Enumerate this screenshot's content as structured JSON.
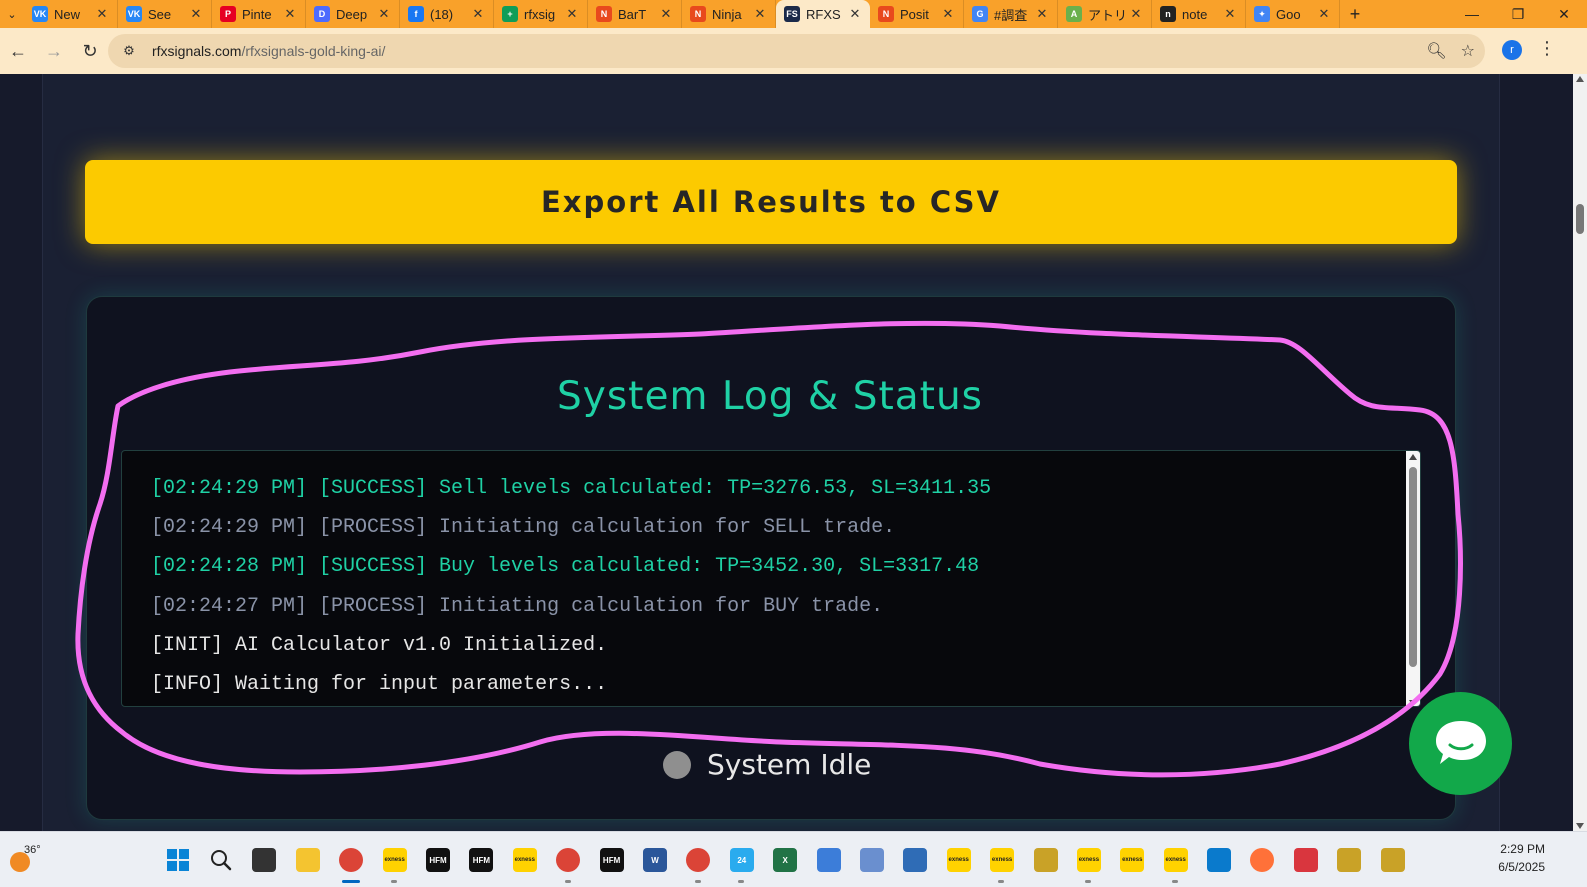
{
  "browser": {
    "tabs": [
      {
        "label": "New",
        "fav_text": "VK",
        "fav_color": "#2787f5"
      },
      {
        "label": "See",
        "fav_text": "VK",
        "fav_color": "#2787f5"
      },
      {
        "label": "Pinte",
        "fav_text": "P",
        "fav_color": "#e60023"
      },
      {
        "label": "Deep",
        "fav_text": "D",
        "fav_color": "#4d6bfe"
      },
      {
        "label": "(18)",
        "fav_text": "f",
        "fav_color": "#1877f2"
      },
      {
        "label": "rfxsig",
        "fav_text": "+",
        "fav_color": "#0f9d58"
      },
      {
        "label": "BarT",
        "fav_text": "N",
        "fav_color": "#e8491d"
      },
      {
        "label": "Ninja",
        "fav_text": "N",
        "fav_color": "#e8491d"
      },
      {
        "label": "RFXS",
        "fav_text": "FS",
        "fav_color": "#1b2a4a",
        "active": true
      },
      {
        "label": "Posit",
        "fav_text": "N",
        "fav_color": "#e8491d"
      },
      {
        "label": "#調査",
        "fav_text": "G",
        "fav_color": "#4285f4"
      },
      {
        "label": "アトリ",
        "fav_text": "A",
        "fav_color": "#6ab04c"
      },
      {
        "label": "note",
        "fav_text": "n",
        "fav_color": "#222222"
      },
      {
        "label": "Goo",
        "fav_text": "✦",
        "fav_color": "#4285f4"
      }
    ],
    "url_host": "rfxsignals.com",
    "url_path": "/rfxsignals-gold-king-ai/",
    "profile_initial": "r"
  },
  "page": {
    "export_button": "Export All Results to CSV",
    "log_title": "System Log & Status",
    "log_lines": [
      {
        "text": "[02:24:29 PM] [SUCCESS] Sell levels calculated: TP=3276.53, SL=3411.35",
        "color": "#1fd1a5"
      },
      {
        "text": "[02:24:29 PM] [PROCESS] Initiating calculation for SELL trade.",
        "color": "#8a93a8"
      },
      {
        "text": "[02:24:28 PM] [SUCCESS] Buy levels calculated: TP=3452.30, SL=3317.48",
        "color": "#1fd1a5"
      },
      {
        "text": "[02:24:27 PM] [PROCESS] Initiating calculation for BUY trade.",
        "color": "#8a93a8"
      },
      {
        "text": "[INIT] AI Calculator v1.0 Initialized.",
        "color": "#e6e6e6"
      },
      {
        "text": "[INFO] Waiting for input parameters...",
        "color": "#e6e6e6"
      }
    ],
    "status_text": "System Idle",
    "status_color": "#8f8f8f",
    "annotation_color": "#f36ef0"
  },
  "taskbar": {
    "weather_temp": "36°",
    "apps": [
      {
        "name": "start-icon",
        "color": "#0078d4",
        "text": ""
      },
      {
        "name": "search-icon",
        "color": "transparent",
        "text": ""
      },
      {
        "name": "task-view-icon",
        "color": "#333333",
        "text": ""
      },
      {
        "name": "file-explorer-icon",
        "color": "#f4c430",
        "text": ""
      },
      {
        "name": "chrome-icon",
        "color": "#db4437",
        "text": ""
      },
      {
        "name": "exness-icon",
        "color": "#ffd200",
        "text": "exness"
      },
      {
        "name": "hfm-icon",
        "color": "#111111",
        "text": "HFM"
      },
      {
        "name": "hfm-icon",
        "color": "#111111",
        "text": "HFM"
      },
      {
        "name": "exness-icon",
        "color": "#ffd200",
        "text": "exness"
      },
      {
        "name": "chrome-icon",
        "color": "#db4437",
        "text": ""
      },
      {
        "name": "hfm-icon",
        "color": "#111111",
        "text": "HFM"
      },
      {
        "name": "word-icon",
        "color": "#2b579a",
        "text": "W"
      },
      {
        "name": "chrome-icon",
        "color": "#db4437",
        "text": ""
      },
      {
        "name": "telegram-icon",
        "color": "#2aabee",
        "text": "24"
      },
      {
        "name": "excel-icon",
        "color": "#217346",
        "text": "X"
      },
      {
        "name": "notepad-icon",
        "color": "#3c7dd9",
        "text": ""
      },
      {
        "name": "control-panel-icon",
        "color": "#6a8fcf",
        "text": ""
      },
      {
        "name": "window-icon",
        "color": "#2f6cb6",
        "text": ""
      },
      {
        "name": "exness-icon",
        "color": "#ffd200",
        "text": "exness"
      },
      {
        "name": "exness-icon",
        "color": "#ffd200",
        "text": "exness"
      },
      {
        "name": "metatrader-icon",
        "color": "#c9a227",
        "text": ""
      },
      {
        "name": "exness-icon",
        "color": "#ffd200",
        "text": "exness"
      },
      {
        "name": "exness-icon",
        "color": "#ffd200",
        "text": "exness"
      },
      {
        "name": "exness-icon",
        "color": "#ffd200",
        "text": "exness"
      },
      {
        "name": "vscode-icon",
        "color": "#0a7acc",
        "text": ""
      },
      {
        "name": "firefox-icon",
        "color": "#ff7139",
        "text": ""
      },
      {
        "name": "snipping-tool-icon",
        "color": "#d9363e",
        "text": ""
      },
      {
        "name": "metatrader-icon",
        "color": "#c9a227",
        "text": ""
      },
      {
        "name": "metatrader-icon",
        "color": "#c9a227",
        "text": ""
      }
    ],
    "time": "2:29 PM",
    "date": "6/5/2025"
  }
}
